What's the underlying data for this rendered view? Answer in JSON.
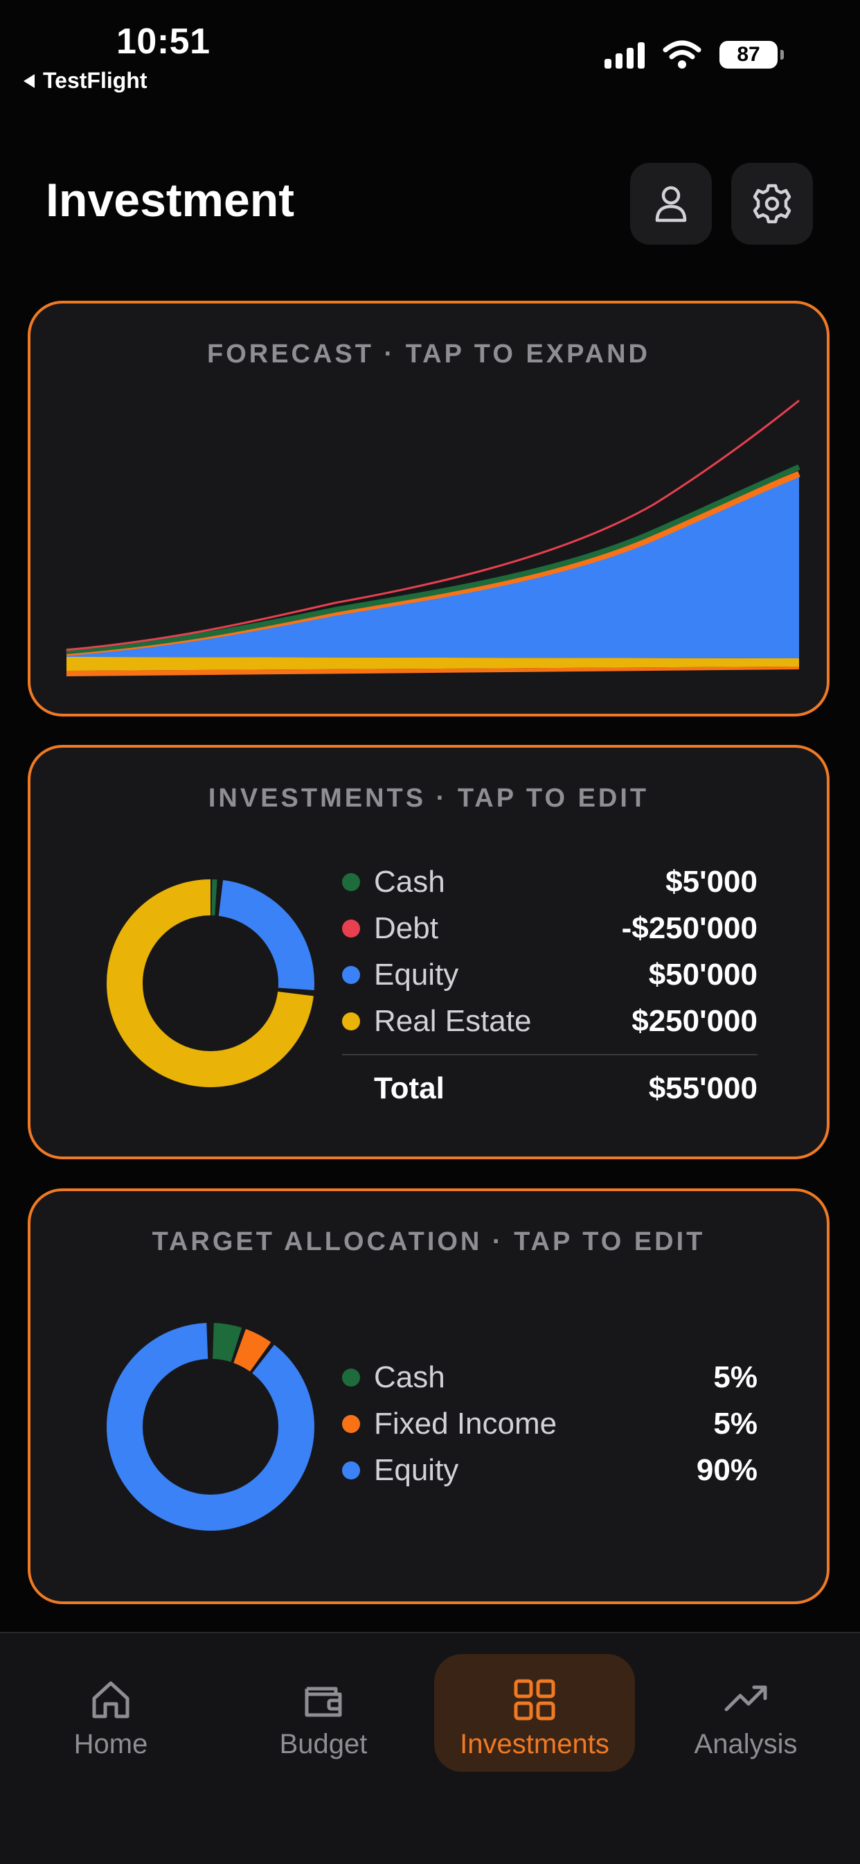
{
  "status": {
    "time": "10:51",
    "back_label": "TestFlight",
    "battery": "87"
  },
  "header": {
    "title": "Investment"
  },
  "forecast": {
    "title": "FORECAST · TAP TO EXPAND"
  },
  "investments": {
    "title": "INVESTMENTS · TAP TO EDIT",
    "items": [
      {
        "label": "Cash",
        "value": "$5'000",
        "color": "#1e6b3c"
      },
      {
        "label": "Debt",
        "value": "-$250'000",
        "color": "#e8404f"
      },
      {
        "label": "Equity",
        "value": "$50'000",
        "color": "#3b82f6"
      },
      {
        "label": "Real Estate",
        "value": "$250'000",
        "color": "#eab308"
      }
    ],
    "total_label": "Total",
    "total_value": "$55'000"
  },
  "target": {
    "title": "TARGET ALLOCATION · TAP TO EDIT",
    "items": [
      {
        "label": "Cash",
        "value": "5%",
        "color": "#1e6b3c"
      },
      {
        "label": "Fixed Income",
        "value": "5%",
        "color": "#f97316"
      },
      {
        "label": "Equity",
        "value": "90%",
        "color": "#3b82f6"
      }
    ]
  },
  "tabs": [
    {
      "label": "Home",
      "icon": "home-icon"
    },
    {
      "label": "Budget",
      "icon": "wallet-icon"
    },
    {
      "label": "Investments",
      "icon": "grid-icon"
    },
    {
      "label": "Analysis",
      "icon": "trend-up-icon"
    }
  ],
  "colors": {
    "accent": "#f07a24",
    "cash": "#1e6b3c",
    "debt": "#e8404f",
    "equity": "#3b82f6",
    "real_estate": "#eab308",
    "fixed_income": "#f97316"
  }
}
